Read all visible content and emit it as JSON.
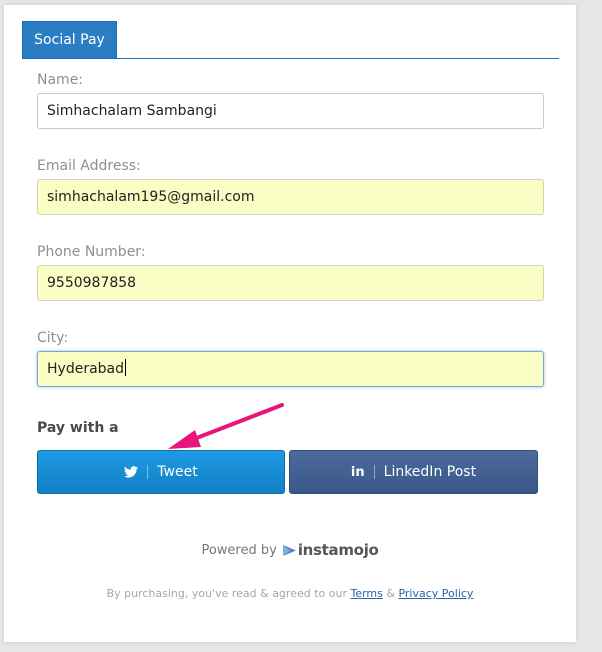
{
  "tabs": [
    {
      "label": "Social Pay",
      "active": true
    }
  ],
  "form": {
    "name": {
      "label": "Name:",
      "value": "Simhachalam Sambangi"
    },
    "email": {
      "label": "Email Address:",
      "value": "simhachalam195@gmail.com"
    },
    "phone": {
      "label": "Phone Number:",
      "value": "9550987858"
    },
    "city": {
      "label": "City:",
      "value": "Hyderabad"
    }
  },
  "pay": {
    "heading": "Pay with a",
    "tweet_label": "Tweet",
    "tweet_icon": "twitter-bird-icon",
    "linkedin_label": "LinkedIn Post",
    "linkedin_icon": "linkedin-icon"
  },
  "footer": {
    "powered_by": "Powered by",
    "brand": "instamojo",
    "legal_prefix": "By purchasing, you've read & agreed to our",
    "terms": "Terms",
    "amp": "&",
    "privacy": "Privacy Policy"
  },
  "colors": {
    "accent": "#2a7fc4",
    "autofill": "#fafdc4",
    "twitter": "#1d8fd6",
    "linkedin": "#45639a",
    "annotation_arrow": "#e8157d"
  }
}
